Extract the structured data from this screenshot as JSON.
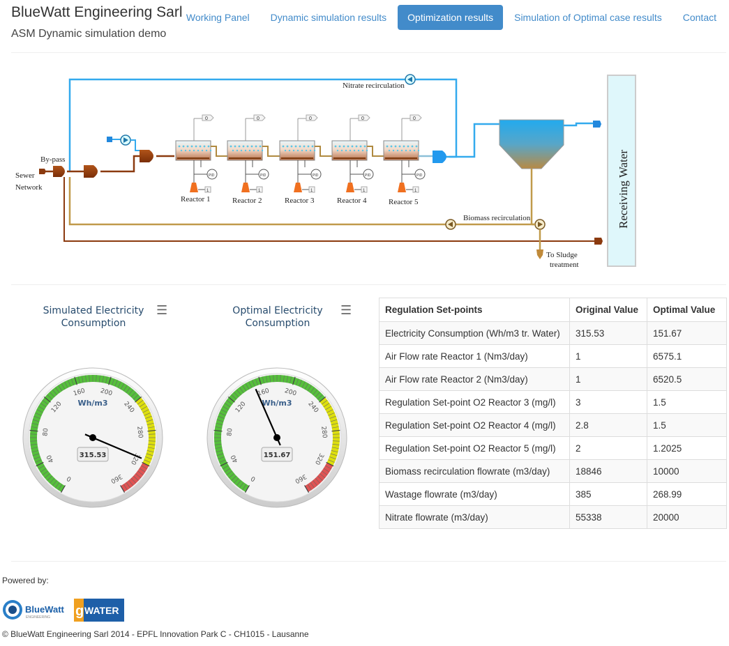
{
  "header": {
    "title": "BlueWatt Engineering Sarl",
    "subtitle": "ASM Dynamic simulation demo"
  },
  "nav": {
    "items": [
      {
        "label": "Working Panel",
        "active": false
      },
      {
        "label": "Dynamic simulation results",
        "active": false
      },
      {
        "label": "Optimization results",
        "active": true
      },
      {
        "label": "Simulation of Optimal case results",
        "active": false
      },
      {
        "label": "Contact",
        "active": false
      }
    ]
  },
  "diagram": {
    "nitrate_recirculation": "Nitrate recirculation",
    "bypass": "By-pass",
    "sewer": "Sewer",
    "network": "Network",
    "reactors": [
      "Reactor 1",
      "Reactor 2",
      "Reactor 3",
      "Reactor 4",
      "Reactor 5"
    ],
    "biomass_recirculation": "Biomass recirculation",
    "to_sludge": "To Sludge",
    "treatment": "treatment",
    "receiving_water": "Receiving Water",
    "pid_label": "PID",
    "sensor_value": "0",
    "dosing_value": "1",
    "colors": {
      "blue_line": "#33aaee",
      "brown_line": "#8b3a0f",
      "sludge_line": "#c09a4a",
      "clarifier_top": "#22aaee",
      "clarifier_bottom": "#b88a44",
      "receiving_fill": "#dff7fb",
      "aerator": "#f07020"
    }
  },
  "gauges": [
    {
      "title_line1": "Simulated Electricity",
      "title_line2": "Consumption",
      "unit": "Wh/m3",
      "value": 315.53,
      "value_text": "315.53",
      "min": 0,
      "max": 360,
      "ticks": [
        "0",
        "40",
        "80",
        "120",
        "160",
        "200",
        "240",
        "280",
        "320",
        "360"
      ],
      "bands": [
        {
          "from": 0,
          "to": 240,
          "color": "#55bf3b"
        },
        {
          "from": 240,
          "to": 320,
          "color": "#dddf0d"
        },
        {
          "from": 320,
          "to": 360,
          "color": "#df5353"
        }
      ]
    },
    {
      "title_line1": "Optimal Electricity",
      "title_line2": "Consumption",
      "unit": "Wh/m3",
      "value": 151.67,
      "value_text": "151.67",
      "min": 0,
      "max": 360,
      "ticks": [
        "0",
        "40",
        "80",
        "120",
        "160",
        "200",
        "240",
        "280",
        "320",
        "360"
      ],
      "bands": [
        {
          "from": 0,
          "to": 240,
          "color": "#55bf3b"
        },
        {
          "from": 240,
          "to": 320,
          "color": "#dddf0d"
        },
        {
          "from": 320,
          "to": 360,
          "color": "#df5353"
        }
      ]
    }
  ],
  "table": {
    "headers": [
      "Regulation Set-points",
      "Original Value",
      "Optimal Value"
    ],
    "rows": [
      [
        "Electricity Consumption (Wh/m3 tr. Water)",
        "315.53",
        "151.67"
      ],
      [
        "Air Flow rate Reactor 1 (Nm3/day)",
        "1",
        "6575.1"
      ],
      [
        "Air Flow rate Reactor 2 (Nm3/day)",
        "1",
        "6520.5"
      ],
      [
        "Regulation Set-point O2 Reactor 3 (mg/l)",
        "3",
        "1.5"
      ],
      [
        "Regulation Set-point O2 Reactor 4 (mg/l)",
        "2.8",
        "1.5"
      ],
      [
        "Regulation Set-point O2 Reactor 5 (mg/l)",
        "2",
        "1.2025"
      ],
      [
        "Biomass recirculation flowrate (m3/day)",
        "18846",
        "10000"
      ],
      [
        "Wastage flowrate (m3/day)",
        "385",
        "268.99"
      ],
      [
        "Nitrate flowrate (m3/day)",
        "55338",
        "20000"
      ]
    ]
  },
  "footer": {
    "powered_by": "Powered by:",
    "copyright": "© BlueWatt Engineering Sarl 2014 - EPFL Innovation Park C - CH1015 - Lausanne",
    "logo1_text": "BlueWatt",
    "logo1_sub": "ENGINEERING",
    "logo2_letter": "g",
    "logo2_text": "WATER"
  }
}
